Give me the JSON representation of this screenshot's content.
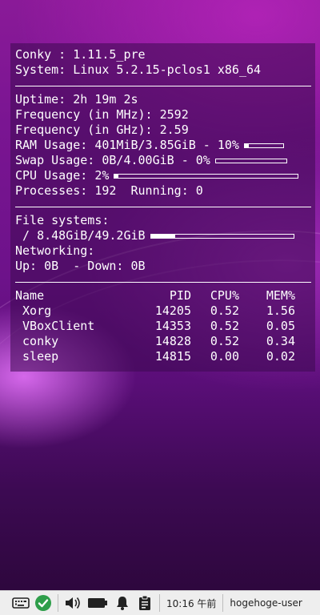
{
  "conky": {
    "header": {
      "conky_label": "Conky : ",
      "conky_version": "1.11.5_pre",
      "system_label": "System: ",
      "system_value": "Linux 5.2.15-pclos1 x86_64"
    },
    "stats": {
      "uptime_label": "Uptime: ",
      "uptime_value": "2h 19m 2s",
      "freq_mhz_label": "Frequency (in MHz): ",
      "freq_mhz_value": "2592",
      "freq_ghz_label": "Frequency (in GHz): ",
      "freq_ghz_value": "2.59",
      "ram_label": "RAM Usage: ",
      "ram_value": "401MiB/3.85GiB - 10%",
      "ram_percent": 10,
      "swap_label": "Swap Usage: ",
      "swap_value": "0B/4.00GiB - 0%",
      "swap_percent": 0,
      "cpu_label": "CPU Usage: ",
      "cpu_value": "2%",
      "cpu_percent": 2,
      "processes_label": "Processes: ",
      "processes_value": "192",
      "running_label": "  Running: ",
      "running_value": "0"
    },
    "fs": {
      "title": "File systems:",
      "root_label": " / ",
      "root_value": "8.48GiB/49.2GiB",
      "root_percent": 17,
      "net_title": "Networking:",
      "up_label": "Up: ",
      "up_value": "0B",
      "down_label": "  - Down: ",
      "down_value": "0B"
    },
    "processes": {
      "headers": [
        "Name",
        "PID",
        "CPU%",
        "MEM%"
      ],
      "rows": [
        {
          "name": " Xorg",
          "pid": "14205",
          "cpu": "0.52",
          "mem": "1.56"
        },
        {
          "name": " VBoxClient",
          "pid": "14353",
          "cpu": "0.52",
          "mem": "0.05"
        },
        {
          "name": " conky",
          "pid": "14828",
          "cpu": "0.52",
          "mem": "0.34"
        },
        {
          "name": " sleep",
          "pid": "14815",
          "cpu": "0.00",
          "mem": "0.02"
        }
      ]
    }
  },
  "taskbar": {
    "clock": "10:16 午前",
    "user": "hogehoge-user",
    "icons": [
      "keyboard-icon",
      "check-icon",
      "volume-icon",
      "battery-icon",
      "bell-icon",
      "clipboard-icon"
    ],
    "check_color": "#2e9e4a"
  }
}
